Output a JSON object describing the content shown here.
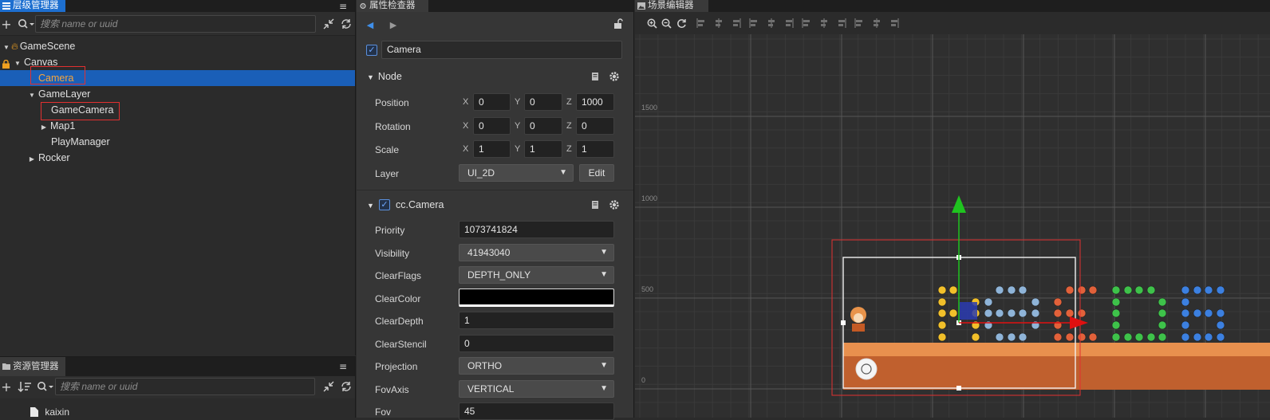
{
  "hierarchy": {
    "tab_title": "层级管理器",
    "menu_icon": "≡",
    "search_placeholder": "搜索 name or uuid",
    "nodes": [
      {
        "label": "GameScene"
      },
      {
        "label": "Canvas"
      },
      {
        "label": "Camera"
      },
      {
        "label": "GameLayer"
      },
      {
        "label": "GameCamera"
      },
      {
        "label": "Map1"
      },
      {
        "label": "PlayManager"
      },
      {
        "label": "Rocker"
      }
    ]
  },
  "assets": {
    "tab_title": "资源管理器",
    "menu_icon": "≡",
    "search_placeholder": "搜索 name or uuid",
    "partial_item": "kaixin"
  },
  "inspector": {
    "tab_title": "属性检查器",
    "node_name": "Camera",
    "node_section": "Node",
    "position": {
      "label": "Position",
      "x": "0",
      "y": "0",
      "z": "1000"
    },
    "rotation": {
      "label": "Rotation",
      "x": "0",
      "y": "0",
      "z": "0"
    },
    "scale": {
      "label": "Scale",
      "x": "1",
      "y": "1",
      "z": "1"
    },
    "axis": {
      "x": "X",
      "y": "Y",
      "z": "Z"
    },
    "layer": {
      "label": "Layer",
      "value": "UI_2D",
      "edit_label": "Edit"
    },
    "camera_section": "cc.Camera",
    "priority": {
      "label": "Priority",
      "value": "1073741824"
    },
    "visibility": {
      "label": "Visibility",
      "value": "41943040"
    },
    "clear_flags": {
      "label": "ClearFlags",
      "value": "DEPTH_ONLY"
    },
    "clear_color": {
      "label": "ClearColor",
      "value": "#000000"
    },
    "clear_depth": {
      "label": "ClearDepth",
      "value": "1"
    },
    "clear_stencil": {
      "label": "ClearStencil",
      "value": "0"
    },
    "projection": {
      "label": "Projection",
      "value": "ORTHO"
    },
    "fov_axis": {
      "label": "FovAxis",
      "value": "VERTICAL"
    },
    "fov": {
      "label": "Fov",
      "value": "45"
    }
  },
  "scene": {
    "tab_title": "场景编辑器",
    "ruler_labels": [
      "1500",
      "1000",
      "500",
      "0"
    ]
  },
  "colors": {
    "selection": "#1a5fb8",
    "active_tab": "#1d6fd0",
    "highlight_box": "#e23030",
    "ground": "#c0602e",
    "gizmo_y": "#1fc41f",
    "gizmo_x": "#e01010"
  }
}
